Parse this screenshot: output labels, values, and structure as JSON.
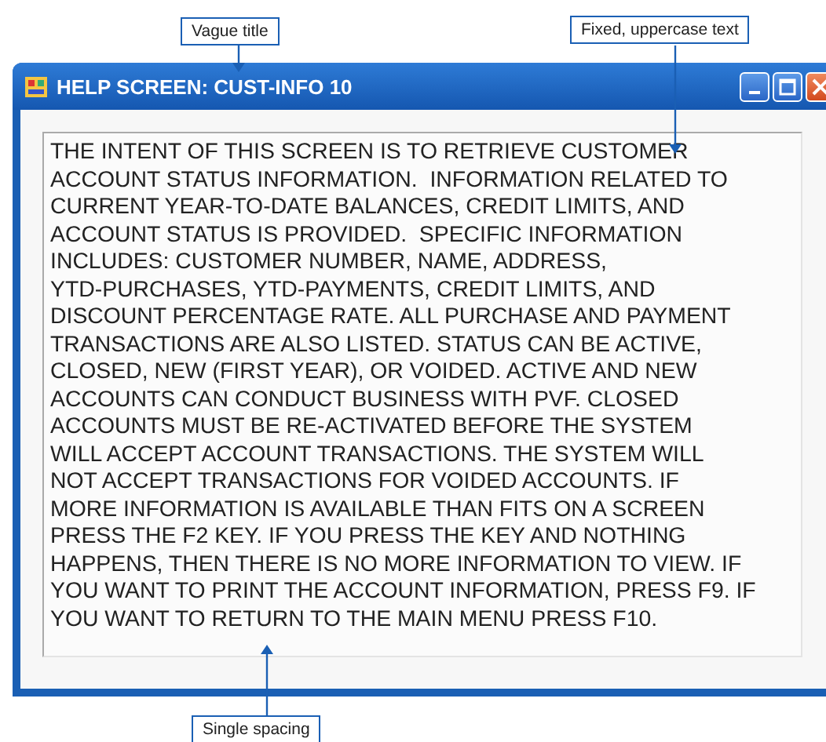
{
  "callouts": [
    {
      "label": "Vague title"
    },
    {
      "label": "Fixed, uppercase text"
    },
    {
      "label": "Single spacing"
    }
  ],
  "window": {
    "title": "HELP SCREEN: CUST-INFO 10"
  },
  "help_text": "THE INTENT OF THIS SCREEN IS TO RETRIEVE CUSTOMER\nACCOUNT STATUS INFORMATION.  INFORMATION RELATED TO\nCURRENT YEAR-TO-DATE BALANCES, CREDIT LIMITS, AND\nACCOUNT STATUS IS PROVIDED.  SPECIFIC INFORMATION\nINCLUDES: CUSTOMER NUMBER, NAME, ADDRESS,\nYTD-PURCHASES, YTD-PAYMENTS, CREDIT LIMITS, AND\nDISCOUNT PERCENTAGE RATE. ALL PURCHASE AND PAYMENT\nTRANSACTIONS ARE ALSO LISTED. STATUS CAN BE ACTIVE,\nCLOSED, NEW (FIRST YEAR), OR VOIDED. ACTIVE AND NEW\nACCOUNTS CAN CONDUCT BUSINESS WITH PVF. CLOSED\nACCOUNTS MUST BE RE-ACTIVATED BEFORE THE SYSTEM\nWILL ACCEPT ACCOUNT TRANSACTIONS. THE SYSTEM WILL\nNOT ACCEPT TRANSACTIONS FOR VOIDED ACCOUNTS. IF\nMORE INFORMATION IS AVAILABLE THAN FITS ON A SCREEN\nPRESS THE F2 KEY. IF YOU PRESS THE KEY AND NOTHING\nHAPPENS, THEN THERE IS NO MORE INFORMATION TO VIEW. IF\nYOU WANT TO PRINT THE ACCOUNT INFORMATION, PRESS F9. IF\nYOU WANT TO RETURN TO THE MAIN MENU PRESS F10."
}
